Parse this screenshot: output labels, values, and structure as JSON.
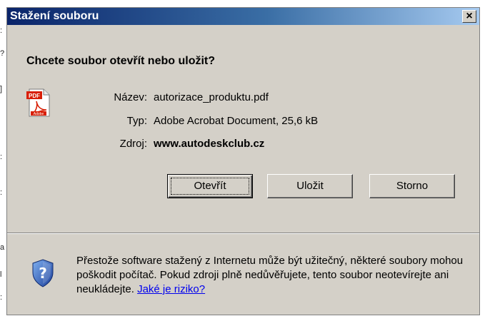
{
  "edge_glyphs": [
    ":",
    "?",
    "]",
    ":",
    ":",
    "a",
    "l",
    ":"
  ],
  "dialog": {
    "title": "Stažení souboru",
    "close_symbol": "×",
    "question": "Chcete soubor otevřít nebo uložit?",
    "file": {
      "icon": "pdf-file-icon",
      "icon_badge": "PDF",
      "icon_brand": "Adobe",
      "name_label": "Název:",
      "name_value": "autorizace_produktu.pdf",
      "type_label": "Typ:",
      "type_value": "Adobe Acrobat Document, 25,6 kB",
      "source_label": "Zdroj:",
      "source_value": "www.autodeskclub.cz"
    },
    "buttons": {
      "open": "Otevřít",
      "save": "Uložit",
      "cancel": "Storno"
    },
    "warning": {
      "icon": "shield-question-icon",
      "text": "Přestože software stažený z Internetu může být užitečný, některé soubory mohou poškodit počítač. Pokud zdroji plně nedůvěřujete, tento soubor neotevírejte ani neukládejte. ",
      "link": "Jaké je riziko?"
    }
  },
  "colors": {
    "titlebar_start": "#0a246a",
    "titlebar_end": "#a6caf0",
    "dialog_face": "#d4d0c8",
    "link": "#0000ee"
  }
}
